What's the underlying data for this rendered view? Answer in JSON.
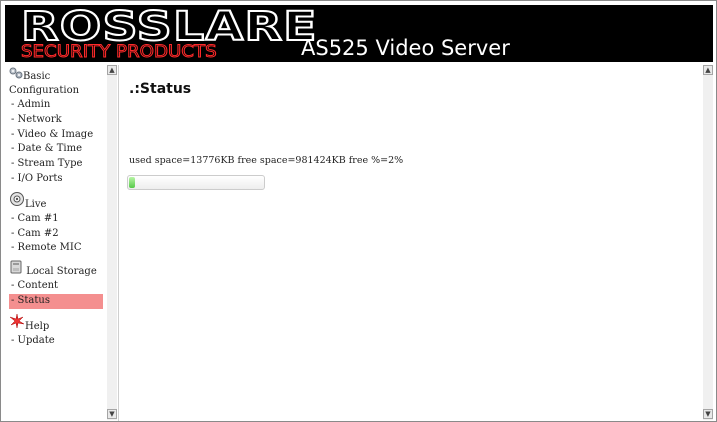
{
  "header": {
    "brand": "ROSSLARE",
    "subtitle": "SECURITY PRODUCTS",
    "product": "AS525 Video Server"
  },
  "nav": {
    "sections": [
      {
        "icon": "gears-icon",
        "label": "Basic Configuration",
        "items": [
          "- Admin",
          "- Network",
          "- Video & Image",
          "- Date & Time",
          "- Stream Type",
          "- I/O Ports"
        ]
      },
      {
        "icon": "camera-dial-icon",
        "label": "Live",
        "items": [
          "- Cam #1",
          "- Cam #2",
          "- Remote MIC"
        ]
      },
      {
        "icon": "storage-drive-icon",
        "label": "Local Storage",
        "items": [
          "- Content",
          "- Status"
        ]
      },
      {
        "icon": "help-star-icon",
        "label": "Help",
        "items": [
          "- Update"
        ]
      }
    ],
    "selected": "- Status"
  },
  "main": {
    "title": ".:Status",
    "status_text": "used space=13776KB free space=981424KB free %=2%",
    "usage_fraction": 0.02
  },
  "colors": {
    "header_bg": "#000000",
    "brand_outline": "#ffffff",
    "subtitle_outline": "#ff2a2a",
    "selected_bg": "#f48f8f",
    "progress_fill": "#57c94a"
  }
}
